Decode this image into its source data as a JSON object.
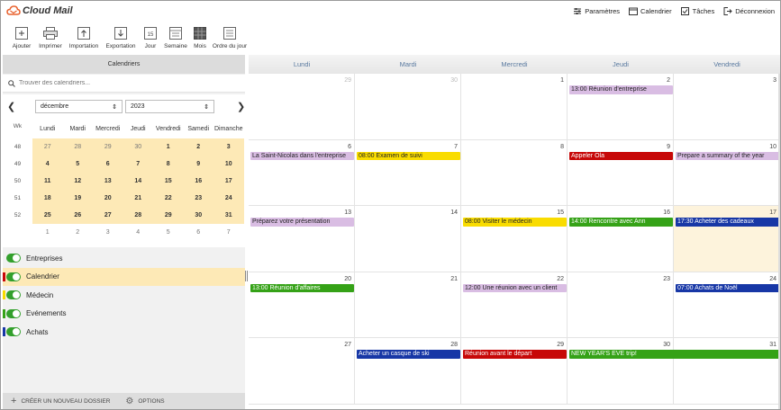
{
  "app": {
    "logo_text": "Cloud Mail"
  },
  "topnav": [
    {
      "label": "Paramètres",
      "icon": "settings-icon"
    },
    {
      "label": "Calendrier",
      "icon": "calendar-icon"
    },
    {
      "label": "Tâches",
      "icon": "tasks-icon"
    },
    {
      "label": "Déconnexion",
      "icon": "logout-icon"
    }
  ],
  "toolbar": {
    "add": "Ajouter",
    "print": "Imprimer",
    "import": "Importation",
    "export": "Exportation",
    "day": "Jour",
    "week": "Semaine",
    "month": "Mois",
    "agenda": "Ordre du jour"
  },
  "sidebar": {
    "header": "Calendriers",
    "search_placeholder": "Trouver des calendriers...",
    "month_select": "décembre",
    "year_select": "2023",
    "week_header": "Wk",
    "weekdays": [
      "Lundi",
      "Mardi",
      "Mercredi",
      "Jeudi",
      "Vendredi",
      "Samedi",
      "Dimanche"
    ],
    "weeks": [
      {
        "wk": "48",
        "days": [
          "27",
          "28",
          "29",
          "30",
          "1",
          "2",
          "3"
        ]
      },
      {
        "wk": "49",
        "days": [
          "4",
          "5",
          "6",
          "7",
          "8",
          "9",
          "10"
        ]
      },
      {
        "wk": "50",
        "days": [
          "11",
          "12",
          "13",
          "14",
          "15",
          "16",
          "17"
        ]
      },
      {
        "wk": "51",
        "days": [
          "18",
          "19",
          "20",
          "21",
          "22",
          "23",
          "24"
        ]
      },
      {
        "wk": "52",
        "days": [
          "25",
          "26",
          "27",
          "28",
          "29",
          "30",
          "31"
        ]
      },
      {
        "wk": "",
        "days": [
          "1",
          "2",
          "3",
          "4",
          "5",
          "6",
          "7"
        ]
      }
    ],
    "calendars": [
      {
        "label": "Entreprises",
        "color": "",
        "active": false
      },
      {
        "label": "Calendrier",
        "color": "#c70808",
        "active": true
      },
      {
        "label": "Médecin",
        "color": "#f9dc00",
        "active": false
      },
      {
        "label": "Evénements",
        "color": "#35a217",
        "active": false
      },
      {
        "label": "Achats",
        "color": "#1737a6",
        "active": false
      }
    ],
    "create_folder": "CRÉER UN NOUVEAU DOSSIER",
    "options": "OPTIONS"
  },
  "calendar": {
    "weekdays": [
      "Lundi",
      "Mardi",
      "Mercredi",
      "Jeudi",
      "Vendredi"
    ],
    "weeks": [
      [
        "28",
        "29",
        "30",
        "1",
        "2"
      ],
      [
        "4",
        "5",
        "6",
        "7",
        "8"
      ],
      [
        "11",
        "12",
        "13",
        "14",
        "15"
      ],
      [
        "18",
        "19",
        "20",
        "21",
        "22"
      ],
      [
        "25",
        "26",
        "27",
        "28",
        "29"
      ]
    ]
  },
  "month_grid_days": [
    [
      "29",
      "30",
      "1",
      "2",
      "3"
    ],
    [
      "6",
      "7",
      "8",
      "9",
      "10"
    ],
    [
      "13",
      "14",
      "15",
      "16",
      "17"
    ],
    [
      "20",
      "21",
      "22",
      "23",
      "24"
    ],
    [
      "27",
      "28",
      "29",
      "30",
      "31"
    ]
  ],
  "events": [
    {
      "week": 0,
      "col": 3,
      "span": 1,
      "slot": 0,
      "text": "13:00 Réunion d'entreprise",
      "color": "purple"
    },
    {
      "week": 1,
      "col": 0,
      "span": 1,
      "slot": 0,
      "text": "La Saint-Nicolas dans l'entreprise",
      "color": "purple"
    },
    {
      "week": 1,
      "col": 1,
      "span": 1,
      "slot": 0,
      "text": "08:00 Examen de suivi",
      "color": "yellow"
    },
    {
      "week": 1,
      "col": 3,
      "span": 1,
      "slot": 0,
      "text": "Appeler Ola",
      "color": "red"
    },
    {
      "week": 1,
      "col": 4,
      "span": 1,
      "slot": 0,
      "text": "Prepare a summary of the year",
      "color": "purple"
    },
    {
      "week": 2,
      "col": 0,
      "span": 1,
      "slot": 0,
      "text": "Préparez votre présentation",
      "color": "purple"
    },
    {
      "week": 2,
      "col": 2,
      "span": 1,
      "slot": 0,
      "text": "08:00 Visiter le médecin",
      "color": "yellow"
    },
    {
      "week": 2,
      "col": 3,
      "span": 1,
      "slot": 0,
      "text": "14:00 Rencontre avec Ann",
      "color": "green"
    },
    {
      "week": 2,
      "col": 4,
      "span": 1,
      "slot": 0,
      "text": "17:30 Acheter des cadeaux",
      "color": "blue"
    },
    {
      "week": 3,
      "col": 0,
      "span": 1,
      "slot": 0,
      "text": "13:00 Réunion d'affaires",
      "color": "green"
    },
    {
      "week": 3,
      "col": 2,
      "span": 1,
      "slot": 0,
      "text": "12:00 Une réunion avec un client",
      "color": "purple"
    },
    {
      "week": 3,
      "col": 4,
      "span": 1,
      "slot": 0,
      "text": "07:00 Achats de Noël",
      "color": "blue"
    },
    {
      "week": 4,
      "col": 1,
      "span": 1,
      "slot": 0,
      "text": "Acheter un casque de ski",
      "color": "blue"
    },
    {
      "week": 4,
      "col": 2,
      "span": 1,
      "slot": 0,
      "text": "Réunion avant le départ",
      "color": "red"
    },
    {
      "week": 4,
      "col": 3,
      "span": 2,
      "slot": 0,
      "text": "NEW YEAR'S EVE trip!",
      "color": "green"
    }
  ]
}
